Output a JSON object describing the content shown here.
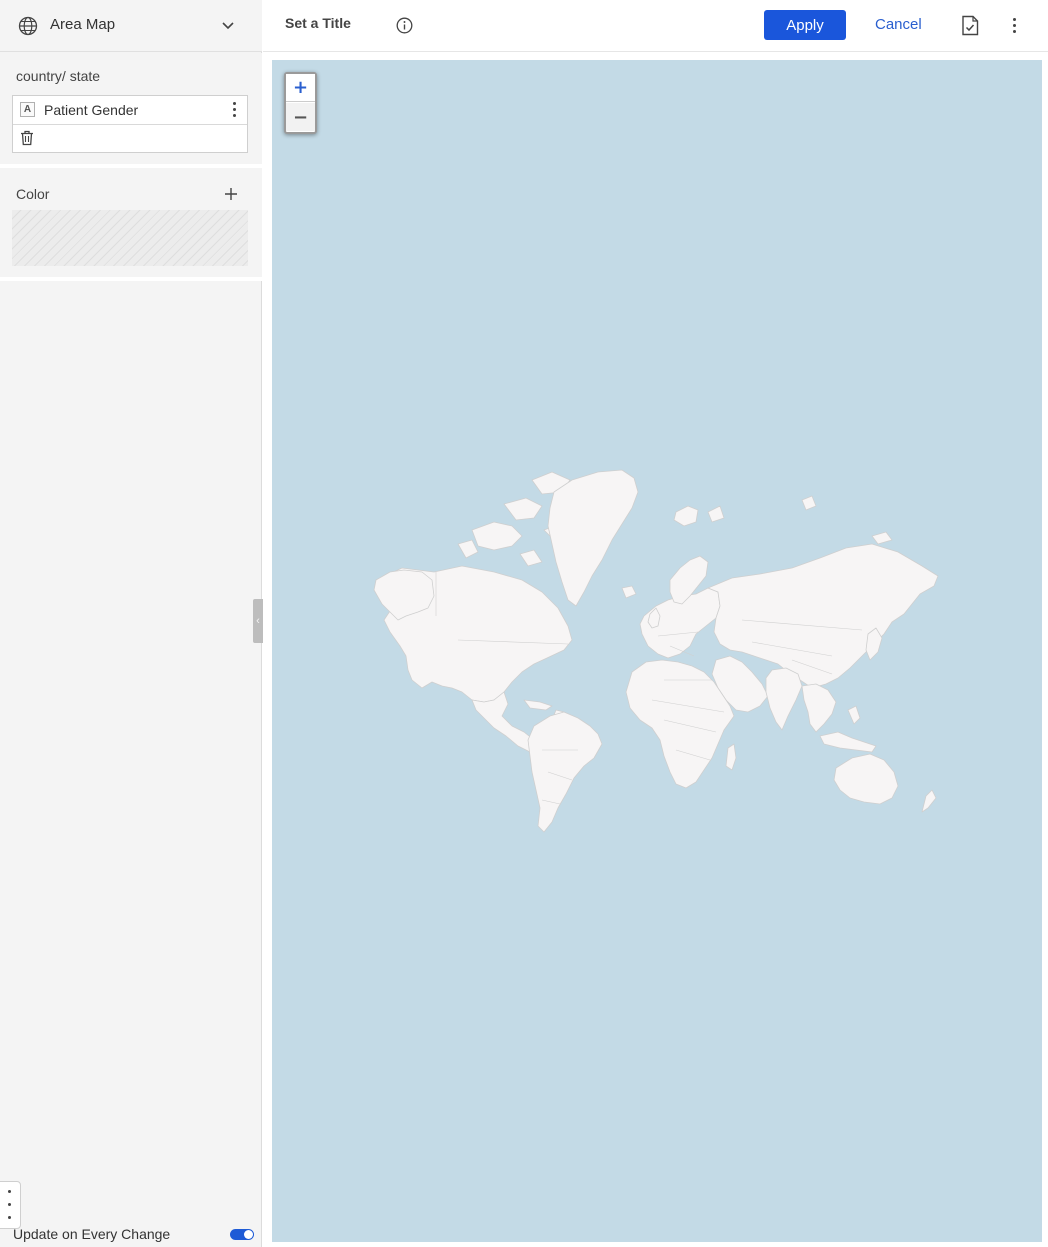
{
  "sidebar": {
    "chart_type": {
      "label": "Area Map",
      "icon": "globe-icon"
    },
    "location_section": {
      "title": "country/ state",
      "field": {
        "type_badge": "A",
        "name": "Patient Gender"
      }
    },
    "color_section": {
      "title": "Color"
    },
    "collapse_glyph": "‹",
    "update_toggle": {
      "label": "Update on Every Change",
      "on": true
    }
  },
  "header": {
    "title": "Set a Title",
    "apply_label": "Apply",
    "cancel_label": "Cancel"
  },
  "map": {
    "zoom_in": "+",
    "zoom_out": "−",
    "colors": {
      "water": "#c3dae6",
      "land": "#f7f5f5",
      "border": "#cccccc"
    }
  },
  "colors": {
    "accent": "#1a56db",
    "link": "#2a5fcf",
    "sidebar_bg": "#f4f4f4"
  }
}
